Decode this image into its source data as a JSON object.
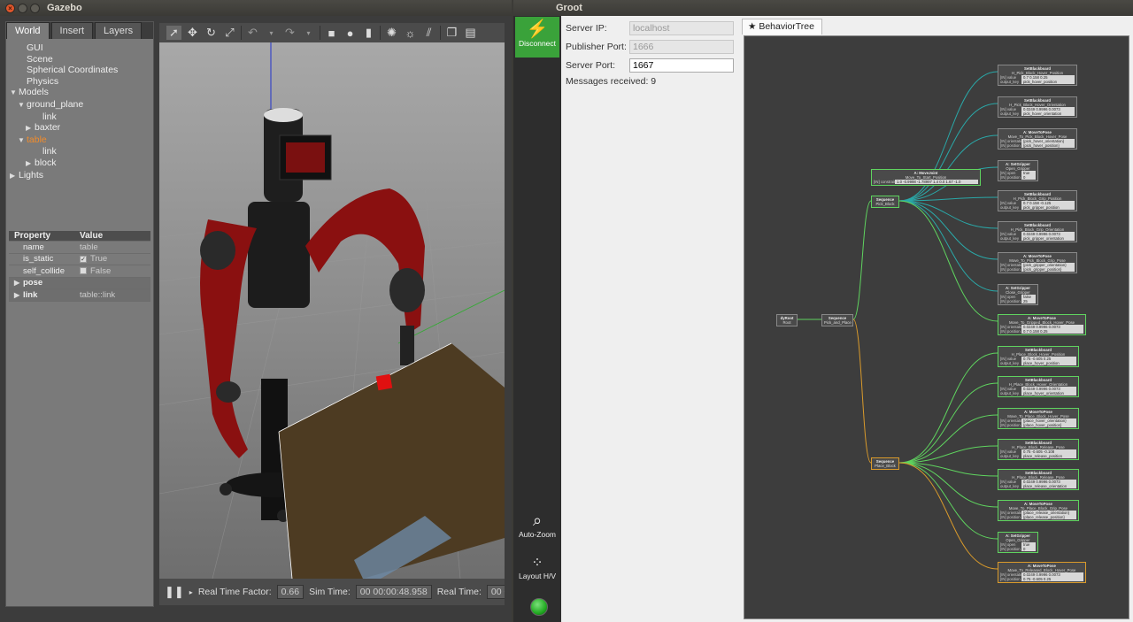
{
  "gazebo": {
    "title": "Gazebo",
    "tabs": [
      "World",
      "Insert",
      "Layers"
    ],
    "tree": [
      {
        "label": "GUI",
        "indent": 1,
        "arrow": ""
      },
      {
        "label": "Scene",
        "indent": 1,
        "arrow": ""
      },
      {
        "label": "Spherical Coordinates",
        "indent": 1,
        "arrow": ""
      },
      {
        "label": "Physics",
        "indent": 1,
        "arrow": ""
      },
      {
        "label": "Models",
        "indent": 0,
        "arrow": "down"
      },
      {
        "label": "ground_plane",
        "indent": 1,
        "arrow": "down"
      },
      {
        "label": "link",
        "indent": 3,
        "arrow": ""
      },
      {
        "label": "baxter",
        "indent": 2,
        "arrow": "right"
      },
      {
        "label": "table",
        "indent": 1,
        "arrow": "down",
        "selected": true
      },
      {
        "label": "link",
        "indent": 3,
        "arrow": ""
      },
      {
        "label": "block",
        "indent": 2,
        "arrow": "right"
      },
      {
        "label": "Lights",
        "indent": 0,
        "arrow": "right"
      }
    ],
    "properties": {
      "header": {
        "property": "Property",
        "value": "Value"
      },
      "name": {
        "key": "name",
        "value": "table"
      },
      "is_static": {
        "key": "is_static",
        "value": "True"
      },
      "self_collide": {
        "key": "self_collide",
        "value": "False"
      },
      "pose": {
        "key": "pose"
      },
      "link": {
        "key": "link",
        "value": "table::link"
      }
    },
    "bottom": {
      "rtf_label": "Real Time Factor:",
      "rtf_value": "0.66",
      "sim_label": "Sim Time:",
      "sim_value": "00 00:00:48.958",
      "real_label": "Real Time:",
      "real_value": "00 00"
    }
  },
  "groot": {
    "title": "Groot",
    "connect_label": "Disconnect",
    "autozoom_label": "Auto-Zoom",
    "layout_label": "Layout H/V",
    "server_ip_label": "Server IP:",
    "server_ip_value": "localhost",
    "publisher_port_label": "Publisher Port:",
    "publisher_port_value": "1666",
    "server_port_label": "Server Port:",
    "server_port_value": "1667",
    "messages_label": "Messages received: 9",
    "tab_label": "BehaviorTree",
    "status_color": "#22aa22"
  },
  "tree": {
    "root": {
      "title": "dyRoot",
      "sub": "Root"
    },
    "pick_and_place": {
      "title": "Sequence",
      "sub": "Pick_and_Place"
    },
    "pick_block": {
      "title": "Sequence",
      "sub": "Pick_Block"
    },
    "place_block": {
      "title": "Sequence",
      "sub": "Place_Block"
    },
    "move_start": {
      "title": "A: MoveJoint",
      "sub": "Move_To_Start_Position",
      "param": "[IN] constraints",
      "val": "1.0 -0.9998 -1.78997 1.4 0.0 1.67 -1.0"
    },
    "pick_nodes": [
      {
        "title": "SetBlackboard",
        "sub": "H_Pick_Block_Hover_Position",
        "p1": "[IN] value",
        "v1": "0.7 0.158 0.25",
        "p2": "output_key",
        "v2": "pick_hover_position"
      },
      {
        "title": "SetBlackboard",
        "sub": "H_Pick_Block_Hover_Orientation",
        "p1": "[IN] value",
        "v1": "0.0249 0.9996 0.0073",
        "p2": "output_key",
        "v2": "pick_hover_orientation"
      },
      {
        "title": "A: MoveToPose",
        "sub": "Move_To_Pick_Block_Hover_Pose",
        "p1": "[IN] orientation",
        "v1": "{pick_hover_orientation}",
        "p2": "[IN] position",
        "v2": "{pick_hover_position}"
      },
      {
        "title": "A: SetGripper",
        "sub": "Open_Gripper",
        "p1": "[IN] open",
        "v1": "true",
        "p2": "[IN] position",
        "v2": "0"
      },
      {
        "title": "SetBlackboard",
        "sub": "H_Pick_Block_Grip_Position",
        "p1": "[IN] value",
        "v1": "0.7 0.158 -0.125",
        "p2": "output_key",
        "v2": "pick_gripper_position"
      },
      {
        "title": "SetBlackboard",
        "sub": "H_Pick_Block_Grip_Orientation",
        "p1": "[IN] value",
        "v1": "0.0249 0.9996 0.0073",
        "p2": "output_key",
        "v2": "pick_gripper_orientation"
      },
      {
        "title": "A: MoveToPose",
        "sub": "Move_To_Pick_Block_Grip_Pose",
        "p1": "[IN] orientation",
        "v1": "{pick_gripper_orientation}",
        "p2": "[IN] position",
        "v2": "{pick_gripper_position}"
      },
      {
        "title": "A: SetGripper",
        "sub": "Close_Gripper",
        "p1": "[IN] open",
        "v1": "false",
        "p2": "[IN] position",
        "v2": "25"
      },
      {
        "title": "A: MoveToPose",
        "sub": "Move_To_Gripped_Block_Hover_Pose",
        "p1": "[IN] orientation",
        "v1": "0.0249 0.9996 0.0073",
        "p2": "[IN] position",
        "v2": "0.7 0.158 0.25"
      }
    ],
    "place_nodes": [
      {
        "title": "SetBlackboard",
        "sub": "H_Place_Block_Hover_Position",
        "p1": "[IN] value",
        "v1": "0.75 -0.605 0.25",
        "p2": "output_key",
        "v2": "place_hover_position"
      },
      {
        "title": "SetBlackboard",
        "sub": "H_Place_Block_Hover_Orientation",
        "p1": "[IN] value",
        "v1": "0.0249 0.9996 0.0073",
        "p2": "output_key",
        "v2": "place_hover_orientation"
      },
      {
        "title": "A: MoveToPose",
        "sub": "Move_To_Place_Block_Hover_Pose",
        "p1": "[IN] orientation",
        "v1": "{place_hover_orientation}",
        "p2": "[IN] position",
        "v2": "{place_hover_position}"
      },
      {
        "title": "SetBlackboard",
        "sub": "H_Place_Block_Release_Pose",
        "p1": "[IN] value",
        "v1": "0.75 -0.605 -0.108",
        "p2": "output_key",
        "v2": "place_release_position"
      },
      {
        "title": "SetBlackboard",
        "sub": "H_Place_Block_Release_Pose",
        "p1": "[IN] value",
        "v1": "0.0249 0.9996 0.0073",
        "p2": "output_key",
        "v2": "place_release_orientation"
      },
      {
        "title": "A: MoveToPose",
        "sub": "Move_To_Place_Block_Grip_Pose",
        "p1": "[IN] orientation",
        "v1": "{place_release_orientation}",
        "p2": "[IN] position",
        "v2": "{place_release_position}"
      },
      {
        "title": "A: SetGripper",
        "sub": "Open_Gripper",
        "p1": "[IN] open",
        "v1": "true",
        "p2": "[IN] position",
        "v2": "0"
      },
      {
        "title": "A: MoveToPose",
        "sub": "Move_To_Released_Block_Hover_Pose",
        "p1": "[IN] orientation",
        "v1": "0.0249 0.9996 0.0073",
        "p2": "[IN] position",
        "v2": "0.75 -0.605 0.25"
      }
    ]
  }
}
